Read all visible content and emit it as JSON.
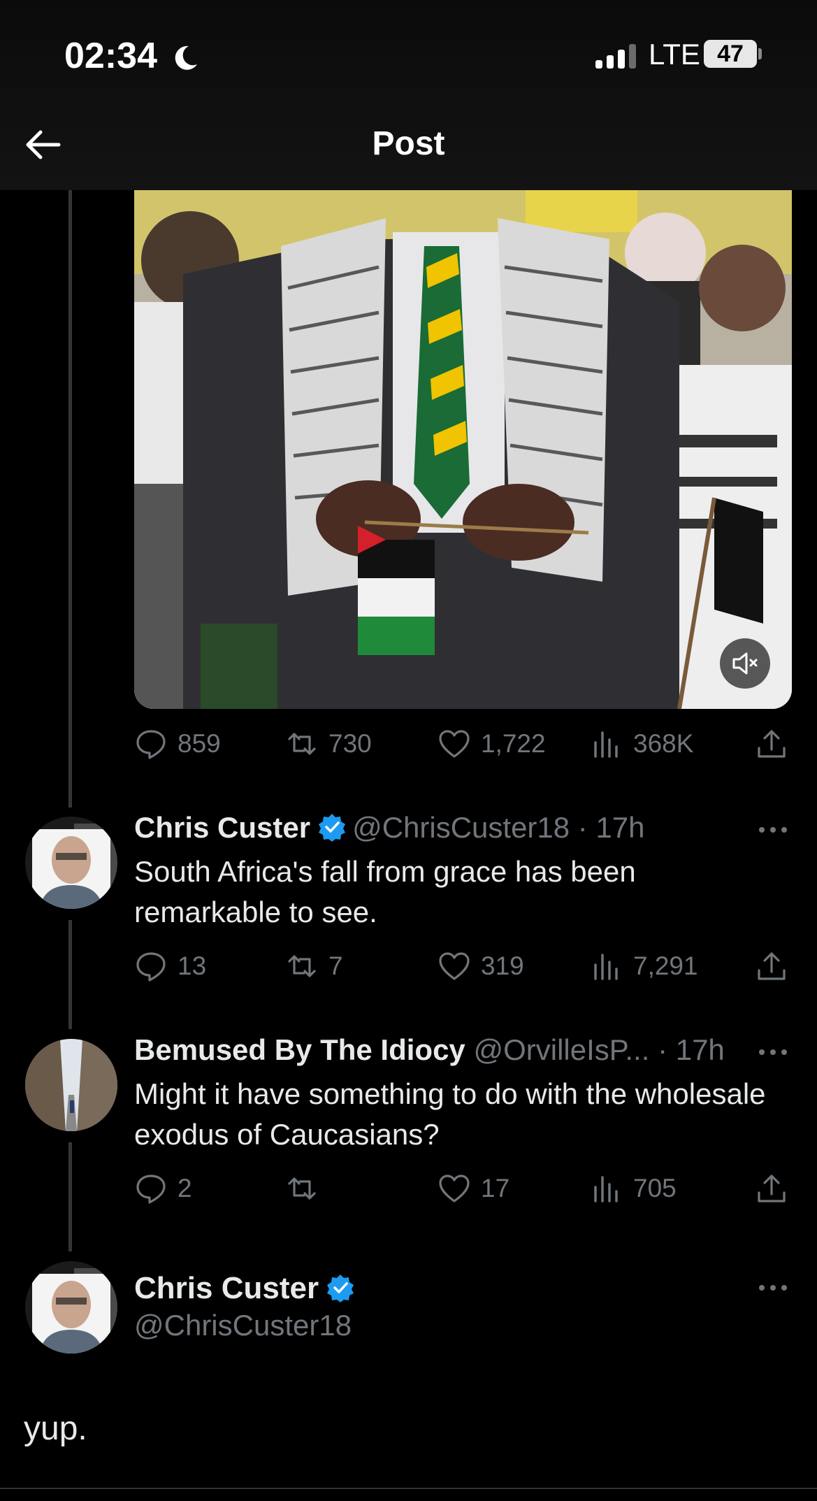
{
  "status_bar": {
    "time": "02:34",
    "network": "LTE",
    "battery": "47"
  },
  "header": {
    "title": "Post"
  },
  "main_tweet": {
    "stats": {
      "replies": "859",
      "reposts": "730",
      "likes": "1,722",
      "views": "368K"
    }
  },
  "replies": [
    {
      "display_name": "Chris Custer",
      "handle": "@ChrisCuster18",
      "time": "· 17h",
      "text": "South Africa's fall from grace has been remarkable to see.",
      "verified": true,
      "stats": {
        "replies": "13",
        "reposts": "7",
        "likes": "319",
        "views": "7,291"
      }
    },
    {
      "display_name": "Bemused By The Idiocy",
      "handle": "@OrvilleIsP...",
      "time": "· 17h",
      "text": "Might it have something to do with the wholesale exodus of Caucasians?",
      "verified": false,
      "stats": {
        "replies": "2",
        "reposts": "",
        "likes": "17",
        "views": "705"
      }
    }
  ],
  "focused_post": {
    "display_name": "Chris Custer",
    "handle": "@ChrisCuster18",
    "verified": true,
    "text": "yup."
  },
  "colors": {
    "background": "#000000",
    "muted": "#71767b",
    "verified_blue": "#1d9bf0",
    "thread_line": "#333639"
  }
}
